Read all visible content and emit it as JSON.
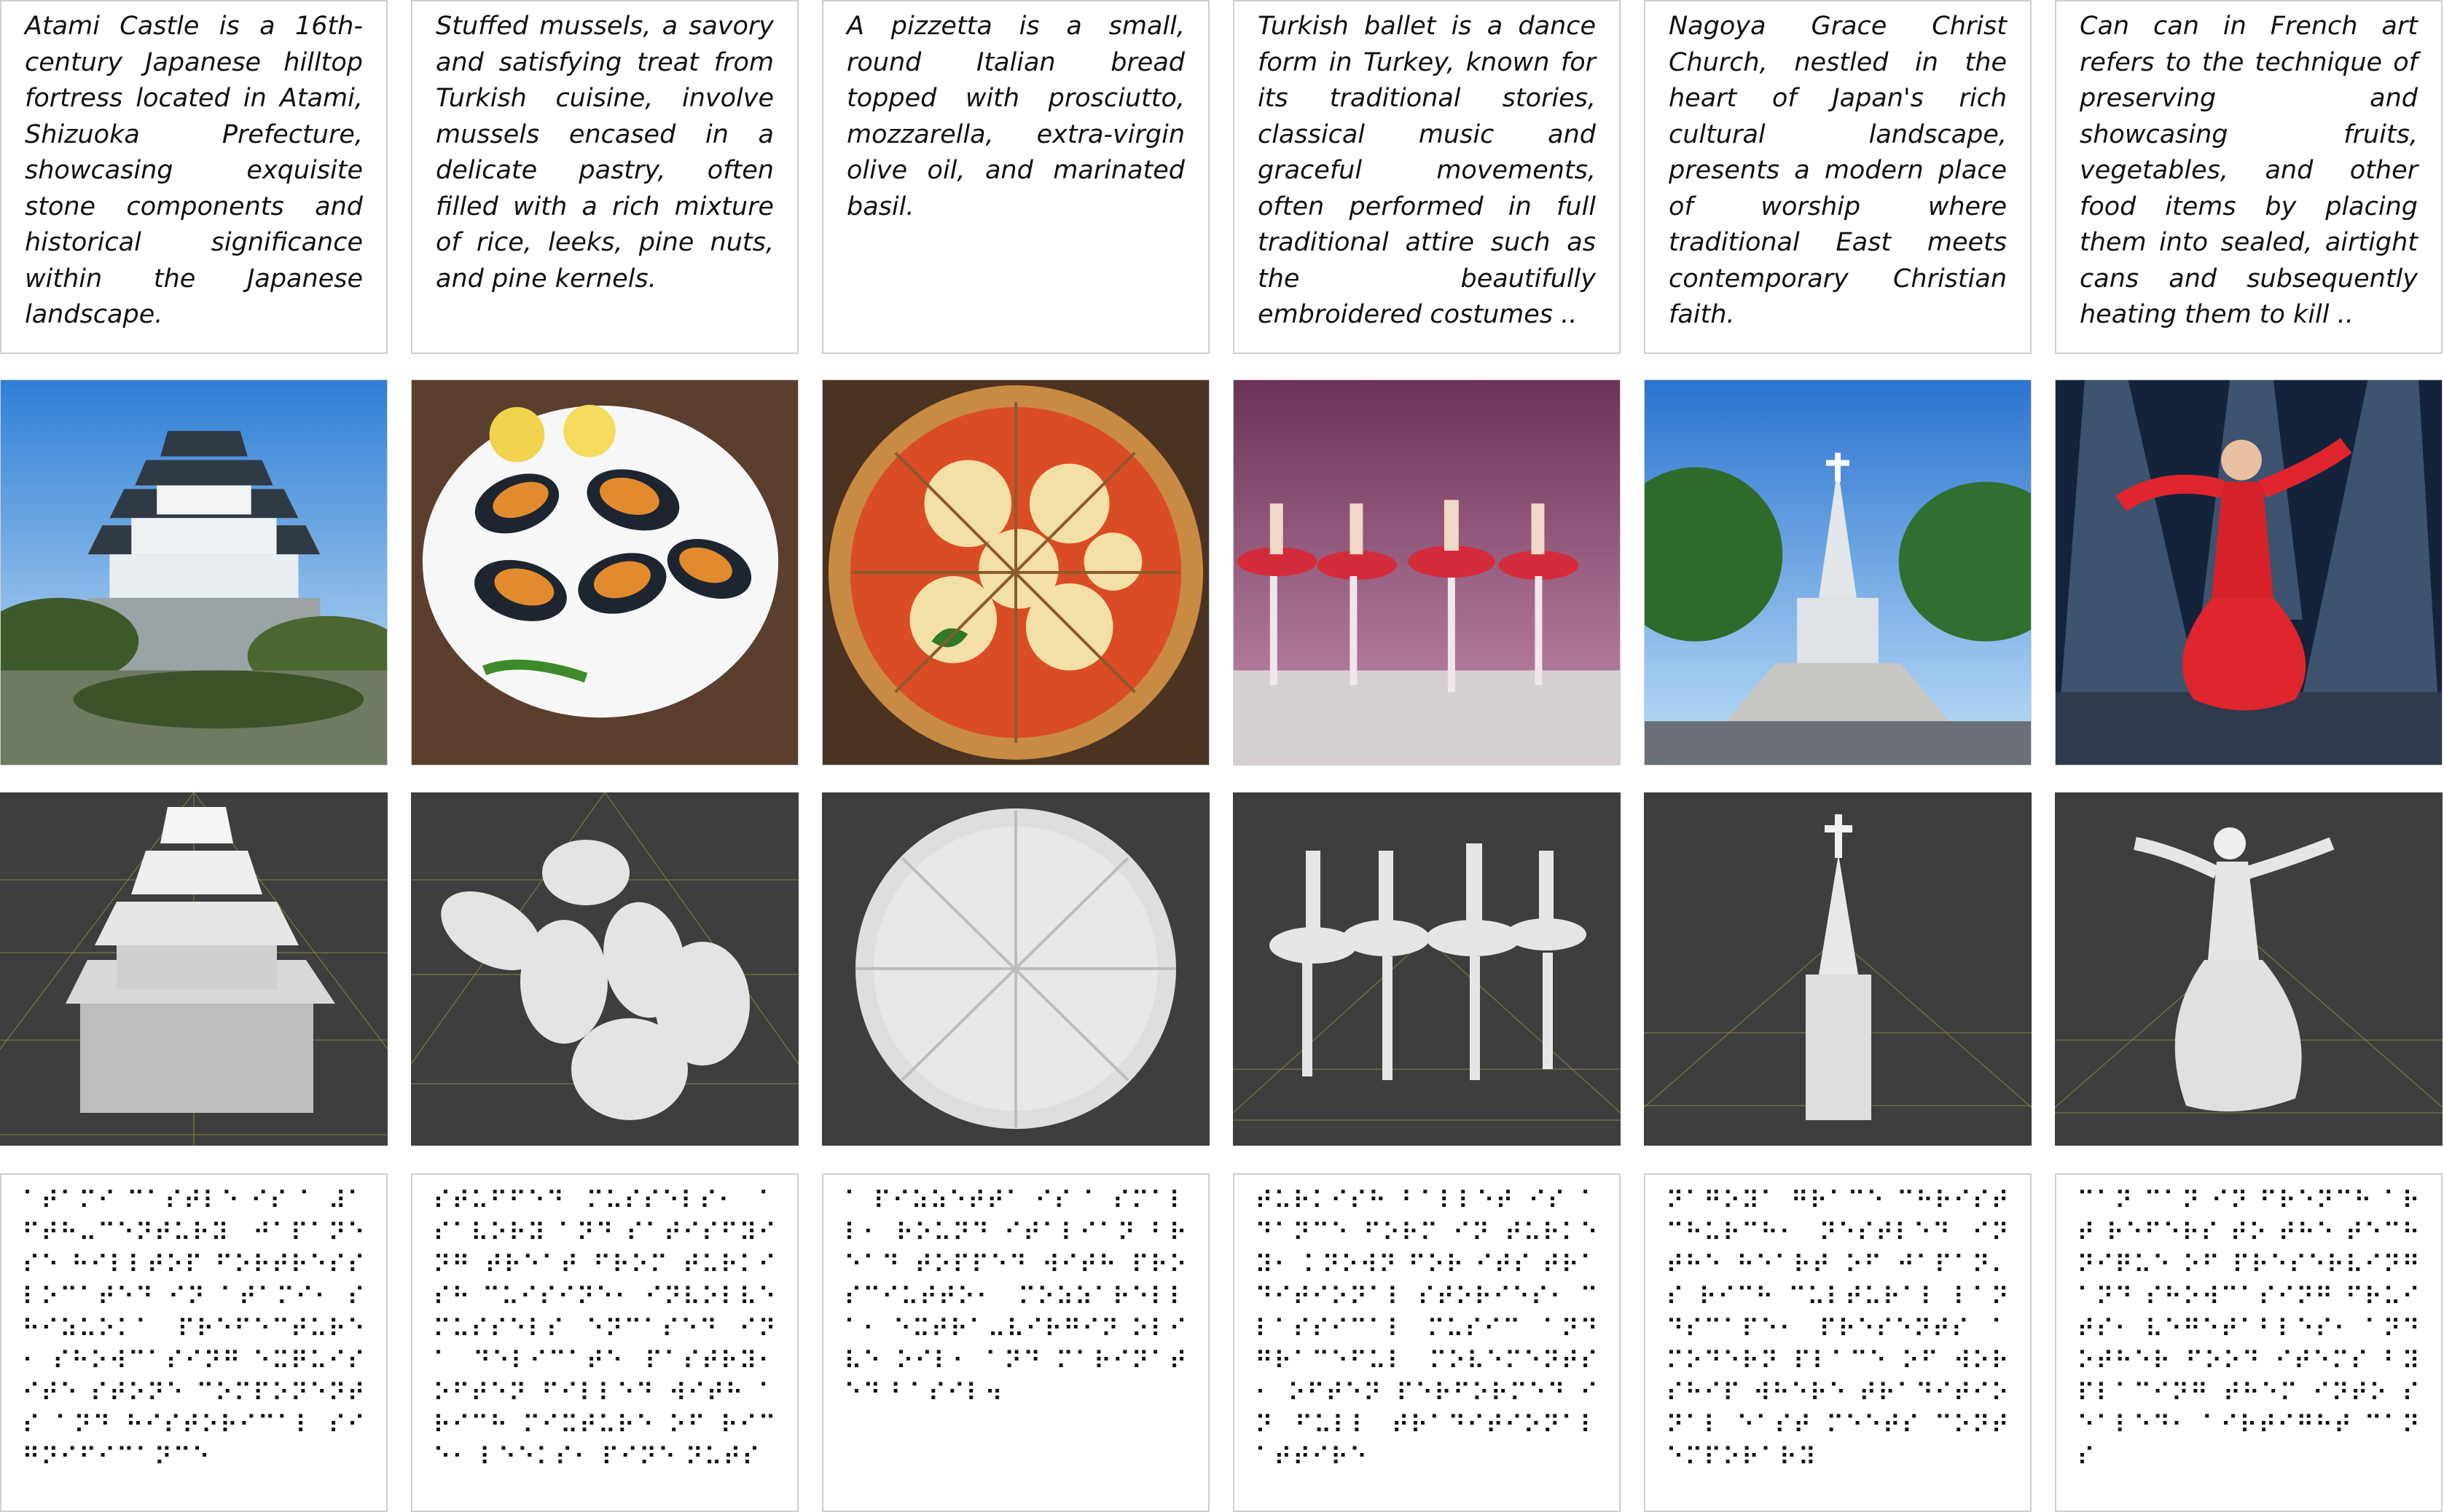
{
  "columns": [
    {
      "description": "Atami Castle is a 16th-century Japanese hilltop fortress located in Atami, Shizuoka Prefecture, showcasing exquisite stone components and historical significance within the Japanese landscape.",
      "photo_subject": "castle",
      "braille": "⠁⠞⠁⠍⠊ ⠉⠁⠎⠞⠇⠑ ⠊⠎ ⠁ ⠼⠁⠋⠞⠓⠤⠉⠑⠝⠞⠥⠗⠽ ⠚⠁⠏⠁⠝⠑⠎⠑ ⠓⠊⠇⠇⠞⠕⠏ ⠋⠕⠗⠞⠗⠑⠎⠎ ⠇⠕⠉⠁⠞⠑⠙ ⠊⠝ ⠁⠞⠁⠍⠊⠂ ⠎⠓⠊⠵⠥⠕⠅⠁ ⠏⠗⠑⠋⠑⠉⠞⠥⠗⠑⠂ ⠎⠓⠕⠺⠉⠁⠎⠊⠝⠛ ⠑⠭⠟⠥⠊⠎⠊⠞⠑ ⠎⠞⠕⠝⠑ ⠉⠕⠍⠏⠕⠝⠑⠝⠞⠎ ⠁⠝⠙ ⠓⠊⠎⠞⠕⠗⠊⠉⠁⠇ ⠎⠊⠛⠝⠊⠋⠊⠉⠁⠝⠉⠑"
    },
    {
      "description": "Stuffed mussels, a savory and satisfying treat from Turkish cuisine, involve mussels encased in a delicate pastry, often filled with a rich mixture of rice, leeks, pine nuts, and pine kernels.",
      "photo_subject": "mussels",
      "braille": "⠎⠞⠥⠋⠋⠑⠙ ⠍⠥⠎⠎⠑⠇⠎⠂ ⠁ ⠎⠁⠧⠕⠗⠽ ⠁⠝⠙ ⠎⠁⠞⠊⠎⠋⠽⠊⠝⠛ ⠞⠗⠑⠁⠞ ⠋⠗⠕⠍ ⠞⠥⠗⠅⠊⠎⠓ ⠉⠥⠊⠎⠊⠝⠑⠂ ⠊⠝⠧⠕⠇⠧⠑ ⠍⠥⠎⠎⠑⠇⠎ ⠑⠝⠉⠁⠎⠑⠙ ⠊⠝ ⠁ ⠙⠑⠇⠊⠉⠁⠞⠑ ⠏⠁⠎⠞⠗⠽⠂ ⠕⠋⠞⠑⠝ ⠋⠊⠇⠇⠑⠙ ⠺⠊⠞⠓ ⠁ ⠗⠊⠉⠓ ⠍⠊⠭⠞⠥⠗⠑ ⠕⠋ ⠗⠊⠉⠑⠂ ⠇⠑⠑⠅⠎⠂ ⠏⠊⠝⠑ ⠝⠥⠞⠎"
    },
    {
      "description": "A pizzetta is a small, round Italian bread topped with prosciutto, mozzarella, extra-virgin olive oil, and marinated basil.",
      "photo_subject": "pizza",
      "braille": "⠁ ⠏⠊⠵⠵⠑⠞⠞⠁ ⠊⠎ ⠁ ⠎⠍⠁⠇⠇⠂ ⠗⠕⠥⠝⠙ ⠊⠞⠁⠇⠊⠁⠝ ⠃⠗⠑⠁⠙ ⠞⠕⠏⠏⠑⠙ ⠺⠊⠞⠓ ⠏⠗⠕⠎⠉⠊⠥⠞⠞⠕⠂ ⠍⠕⠵⠵⠁⠗⠑⠇⠇⠁⠂ ⠑⠭⠞⠗⠁⠤⠧⠊⠗⠛⠊⠝ ⠕⠇⠊⠧⠑ ⠕⠊⠇⠂ ⠁⠝⠙ ⠍⠁⠗⠊⠝⠁⠞⠑⠙ ⠃⠁⠎⠊⠇⠲"
    },
    {
      "description": "Turkish ballet is a dance form in Turkey, known for its traditional stories, classical music and graceful movements, often performed in full traditional attire such as the beautifully embroidered costumes ..",
      "photo_subject": "ballet",
      "braille": "⠞⠥⠗⠅⠊⠎⠓ ⠃⠁⠇⠇⠑⠞ ⠊⠎ ⠁ ⠙⠁⠝⠉⠑ ⠋⠕⠗⠍ ⠊⠝ ⠞⠥⠗⠅⠑⠽⠂ ⠅⠝⠕⠺⠝ ⠋⠕⠗ ⠊⠞⠎ ⠞⠗⠁⠙⠊⠞⠊⠕⠝⠁⠇ ⠎⠞⠕⠗⠊⠑⠎⠂ ⠉⠇⠁⠎⠎⠊⠉⠁⠇ ⠍⠥⠎⠊⠉ ⠁⠝⠙ ⠛⠗⠁⠉⠑⠋⠥⠇ ⠍⠕⠧⠑⠍⠑⠝⠞⠎⠂ ⠕⠋⠞⠑⠝ ⠏⠑⠗⠋⠕⠗⠍⠑⠙ ⠊⠝ ⠋⠥⠇⠇ ⠞⠗⠁⠙⠊⠞⠊⠕⠝⠁⠇ ⠁⠞⠞⠊⠗⠑"
    },
    {
      "description": "Nagoya Grace Christ Church, nestled in the heart of Japan's rich cultural landscape, presents a modern place of worship where traditional East meets contemporary Christian faith.",
      "photo_subject": "church",
      "braille": "⠝⠁⠛⠕⠽⠁ ⠛⠗⠁⠉⠑ ⠉⠓⠗⠊⠎⠞ ⠉⠓⠥⠗⠉⠓⠂ ⠝⠑⠎⠞⠇⠑⠙ ⠊⠝ ⠞⠓⠑ ⠓⠑⠁⠗⠞ ⠕⠋ ⠚⠁⠏⠁⠝⠄⠎ ⠗⠊⠉⠓ ⠉⠥⠇⠞⠥⠗⠁⠇ ⠇⠁⠝⠙⠎⠉⠁⠏⠑⠂ ⠏⠗⠑⠎⠑⠝⠞⠎ ⠁ ⠍⠕⠙⠑⠗⠝ ⠏⠇⠁⠉⠑ ⠕⠋ ⠺⠕⠗⠎⠓⠊⠏ ⠺⠓⠑⠗⠑ ⠞⠗⠁⠙⠊⠞⠊⠕⠝⠁⠇ ⠑⠁⠎⠞ ⠍⠑⠑⠞⠎ ⠉⠕⠝⠞⠑⠍⠏⠕⠗⠁⠗⠽"
    },
    {
      "description": "Can can in French art refers to the technique of preserving and showcasing fruits, vegetables, and other food items by placing them into sealed, airtight cans and subsequently heating them to kill ..",
      "photo_subject": "dancer",
      "braille": "⠉⠁⠝ ⠉⠁⠝ ⠊⠝ ⠋⠗⠑⠝⠉⠓ ⠁⠗⠞ ⠗⠑⠋⠑⠗⠎ ⠞⠕ ⠞⠓⠑ ⠞⠑⠉⠓⠝⠊⠟⠥⠑ ⠕⠋ ⠏⠗⠑⠎⠑⠗⠧⠊⠝⠛ ⠁⠝⠙ ⠎⠓⠕⠺⠉⠁⠎⠊⠝⠛ ⠋⠗⠥⠊⠞⠎⠂ ⠧⠑⠛⠑⠞⠁⠃⠇⠑⠎⠂ ⠁⠝⠙ ⠕⠞⠓⠑⠗ ⠋⠕⠕⠙ ⠊⠞⠑⠍⠎ ⠃⠽ ⠏⠇⠁⠉⠊⠝⠛ ⠞⠓⠑⠍ ⠊⠝⠞⠕ ⠎⠑⠁⠇⠑⠙⠂ ⠁⠊⠗⠞⠊⠛⠓⠞ ⠉⠁⠝⠎"
    }
  ]
}
